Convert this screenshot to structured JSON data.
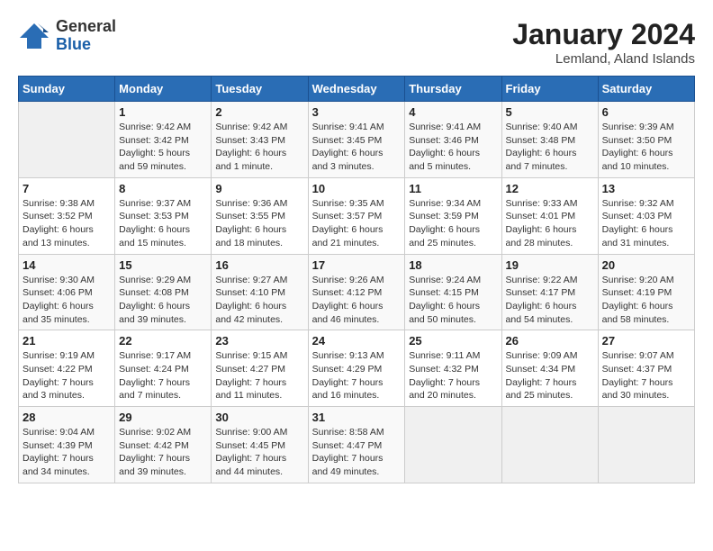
{
  "header": {
    "logo": {
      "general": "General",
      "blue": "Blue"
    },
    "title": "January 2024",
    "location": "Lemland, Aland Islands"
  },
  "weekdays": [
    "Sunday",
    "Monday",
    "Tuesday",
    "Wednesday",
    "Thursday",
    "Friday",
    "Saturday"
  ],
  "weeks": [
    [
      {
        "day": "",
        "sunrise": "",
        "sunset": "",
        "daylight": ""
      },
      {
        "day": "1",
        "sunrise": "Sunrise: 9:42 AM",
        "sunset": "Sunset: 3:42 PM",
        "daylight": "Daylight: 5 hours and 59 minutes."
      },
      {
        "day": "2",
        "sunrise": "Sunrise: 9:42 AM",
        "sunset": "Sunset: 3:43 PM",
        "daylight": "Daylight: 6 hours and 1 minute."
      },
      {
        "day": "3",
        "sunrise": "Sunrise: 9:41 AM",
        "sunset": "Sunset: 3:45 PM",
        "daylight": "Daylight: 6 hours and 3 minutes."
      },
      {
        "day": "4",
        "sunrise": "Sunrise: 9:41 AM",
        "sunset": "Sunset: 3:46 PM",
        "daylight": "Daylight: 6 hours and 5 minutes."
      },
      {
        "day": "5",
        "sunrise": "Sunrise: 9:40 AM",
        "sunset": "Sunset: 3:48 PM",
        "daylight": "Daylight: 6 hours and 7 minutes."
      },
      {
        "day": "6",
        "sunrise": "Sunrise: 9:39 AM",
        "sunset": "Sunset: 3:50 PM",
        "daylight": "Daylight: 6 hours and 10 minutes."
      }
    ],
    [
      {
        "day": "7",
        "sunrise": "Sunrise: 9:38 AM",
        "sunset": "Sunset: 3:52 PM",
        "daylight": "Daylight: 6 hours and 13 minutes."
      },
      {
        "day": "8",
        "sunrise": "Sunrise: 9:37 AM",
        "sunset": "Sunset: 3:53 PM",
        "daylight": "Daylight: 6 hours and 15 minutes."
      },
      {
        "day": "9",
        "sunrise": "Sunrise: 9:36 AM",
        "sunset": "Sunset: 3:55 PM",
        "daylight": "Daylight: 6 hours and 18 minutes."
      },
      {
        "day": "10",
        "sunrise": "Sunrise: 9:35 AM",
        "sunset": "Sunset: 3:57 PM",
        "daylight": "Daylight: 6 hours and 21 minutes."
      },
      {
        "day": "11",
        "sunrise": "Sunrise: 9:34 AM",
        "sunset": "Sunset: 3:59 PM",
        "daylight": "Daylight: 6 hours and 25 minutes."
      },
      {
        "day": "12",
        "sunrise": "Sunrise: 9:33 AM",
        "sunset": "Sunset: 4:01 PM",
        "daylight": "Daylight: 6 hours and 28 minutes."
      },
      {
        "day": "13",
        "sunrise": "Sunrise: 9:32 AM",
        "sunset": "Sunset: 4:03 PM",
        "daylight": "Daylight: 6 hours and 31 minutes."
      }
    ],
    [
      {
        "day": "14",
        "sunrise": "Sunrise: 9:30 AM",
        "sunset": "Sunset: 4:06 PM",
        "daylight": "Daylight: 6 hours and 35 minutes."
      },
      {
        "day": "15",
        "sunrise": "Sunrise: 9:29 AM",
        "sunset": "Sunset: 4:08 PM",
        "daylight": "Daylight: 6 hours and 39 minutes."
      },
      {
        "day": "16",
        "sunrise": "Sunrise: 9:27 AM",
        "sunset": "Sunset: 4:10 PM",
        "daylight": "Daylight: 6 hours and 42 minutes."
      },
      {
        "day": "17",
        "sunrise": "Sunrise: 9:26 AM",
        "sunset": "Sunset: 4:12 PM",
        "daylight": "Daylight: 6 hours and 46 minutes."
      },
      {
        "day": "18",
        "sunrise": "Sunrise: 9:24 AM",
        "sunset": "Sunset: 4:15 PM",
        "daylight": "Daylight: 6 hours and 50 minutes."
      },
      {
        "day": "19",
        "sunrise": "Sunrise: 9:22 AM",
        "sunset": "Sunset: 4:17 PM",
        "daylight": "Daylight: 6 hours and 54 minutes."
      },
      {
        "day": "20",
        "sunrise": "Sunrise: 9:20 AM",
        "sunset": "Sunset: 4:19 PM",
        "daylight": "Daylight: 6 hours and 58 minutes."
      }
    ],
    [
      {
        "day": "21",
        "sunrise": "Sunrise: 9:19 AM",
        "sunset": "Sunset: 4:22 PM",
        "daylight": "Daylight: 7 hours and 3 minutes."
      },
      {
        "day": "22",
        "sunrise": "Sunrise: 9:17 AM",
        "sunset": "Sunset: 4:24 PM",
        "daylight": "Daylight: 7 hours and 7 minutes."
      },
      {
        "day": "23",
        "sunrise": "Sunrise: 9:15 AM",
        "sunset": "Sunset: 4:27 PM",
        "daylight": "Daylight: 7 hours and 11 minutes."
      },
      {
        "day": "24",
        "sunrise": "Sunrise: 9:13 AM",
        "sunset": "Sunset: 4:29 PM",
        "daylight": "Daylight: 7 hours and 16 minutes."
      },
      {
        "day": "25",
        "sunrise": "Sunrise: 9:11 AM",
        "sunset": "Sunset: 4:32 PM",
        "daylight": "Daylight: 7 hours and 20 minutes."
      },
      {
        "day": "26",
        "sunrise": "Sunrise: 9:09 AM",
        "sunset": "Sunset: 4:34 PM",
        "daylight": "Daylight: 7 hours and 25 minutes."
      },
      {
        "day": "27",
        "sunrise": "Sunrise: 9:07 AM",
        "sunset": "Sunset: 4:37 PM",
        "daylight": "Daylight: 7 hours and 30 minutes."
      }
    ],
    [
      {
        "day": "28",
        "sunrise": "Sunrise: 9:04 AM",
        "sunset": "Sunset: 4:39 PM",
        "daylight": "Daylight: 7 hours and 34 minutes."
      },
      {
        "day": "29",
        "sunrise": "Sunrise: 9:02 AM",
        "sunset": "Sunset: 4:42 PM",
        "daylight": "Daylight: 7 hours and 39 minutes."
      },
      {
        "day": "30",
        "sunrise": "Sunrise: 9:00 AM",
        "sunset": "Sunset: 4:45 PM",
        "daylight": "Daylight: 7 hours and 44 minutes."
      },
      {
        "day": "31",
        "sunrise": "Sunrise: 8:58 AM",
        "sunset": "Sunset: 4:47 PM",
        "daylight": "Daylight: 7 hours and 49 minutes."
      },
      {
        "day": "",
        "sunrise": "",
        "sunset": "",
        "daylight": ""
      },
      {
        "day": "",
        "sunrise": "",
        "sunset": "",
        "daylight": ""
      },
      {
        "day": "",
        "sunrise": "",
        "sunset": "",
        "daylight": ""
      }
    ]
  ]
}
